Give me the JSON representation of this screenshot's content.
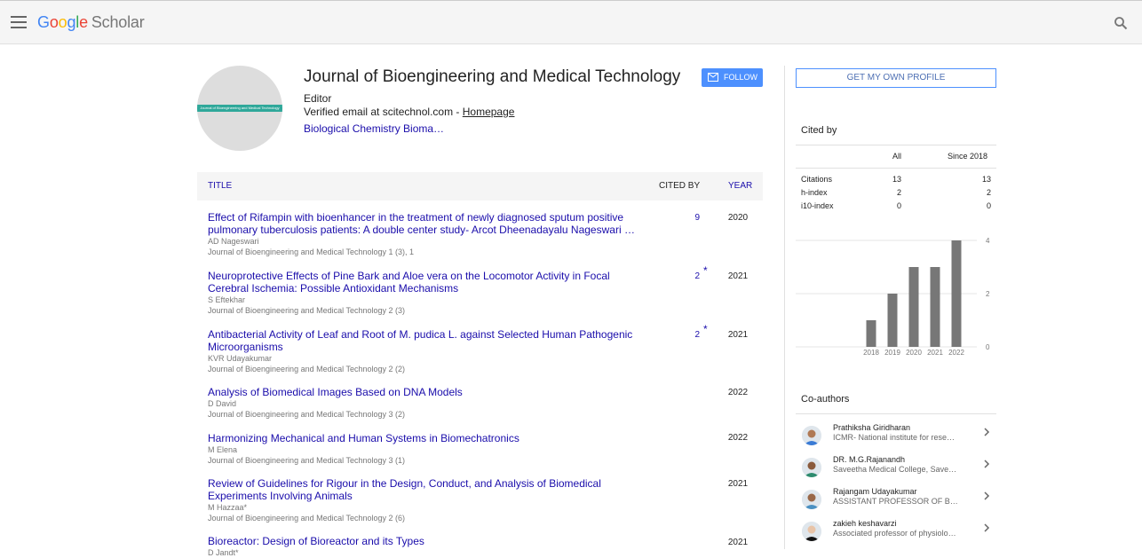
{
  "header": {
    "logo_google": [
      "G",
      "o",
      "o",
      "g",
      "l",
      "e"
    ],
    "logo_scholar": "Scholar"
  },
  "profile": {
    "avatar_band_text": "Journal of Bioengineering and Medical Technology",
    "name": "Journal of Bioengineering and Medical Technology",
    "affiliation": "Editor",
    "email_prefix": "Verified email at scitechnol.com - ",
    "homepage_label": "Homepage",
    "interests": "Biological Chemistry Bioma…",
    "follow_label": "FOLLOW"
  },
  "table": {
    "headers": {
      "title": "TITLE",
      "cited_by": "CITED BY",
      "year": "YEAR"
    },
    "rows": [
      {
        "title": "Effect of Rifampin with bioenhancer in the treatment of newly diagnosed sputum positive pulmonary tuberculosis patients: A double center study- Arcot Dheenadayalu Nageswari …",
        "authors": "AD Nageswari",
        "venue": "Journal of Bioengineering and Medical Technology 1 (3), 1",
        "cited": "9",
        "star": "",
        "year": "2020"
      },
      {
        "title": "Neuroprotective Effects of Pine Bark and Aloe vera on the Locomotor Activity in Focal Cerebral Ischemia: Possible Antioxidant Mechanisms",
        "authors": "S Eftekhar",
        "venue": "Journal of Bioengineering and Medical Technology 2 (3)",
        "cited": "2",
        "star": "*",
        "year": "2021"
      },
      {
        "title": "Antibacterial Activity of Leaf and Root of M. pudica L. against Selected Human Pathogenic Microorganisms",
        "authors": "KVR Udayakumar",
        "venue": "Journal of Bioengineering and Medical Technology 2 (2)",
        "cited": "2",
        "star": "*",
        "year": "2021"
      },
      {
        "title": "Analysis of Biomedical Images Based on DNA Models",
        "authors": "D David",
        "venue": "Journal of Bioengineering and Medical Technology 3 (2)",
        "cited": "",
        "star": "",
        "year": "2022"
      },
      {
        "title": "Harmonizing Mechanical and Human Systems in Biomechatronics",
        "authors": "M Elena",
        "venue": "Journal of Bioengineering and Medical Technology 3 (1)",
        "cited": "",
        "star": "",
        "year": "2022"
      },
      {
        "title": "Review of Guidelines for Rigour in the Design, Conduct, and Analysis of Biomedical Experiments Involving Animals",
        "authors": "M Hazzaa*",
        "venue": "Journal of Bioengineering and Medical Technology 2 (6)",
        "cited": "",
        "star": "",
        "year": "2021"
      },
      {
        "title": "Bioreactor: Design of Bioreactor and its Types",
        "authors": "D Jandt*",
        "venue": "",
        "cited": "",
        "star": "",
        "year": "2021"
      }
    ]
  },
  "sidebar": {
    "get_profile_label": "GET MY OWN PROFILE",
    "cited_by_title": "Cited by",
    "col_all": "All",
    "col_since": "Since 2018",
    "stats": [
      {
        "label": "Citations",
        "all": "13",
        "since": "13"
      },
      {
        "label": "h-index",
        "all": "2",
        "since": "2"
      },
      {
        "label": "i10-index",
        "all": "0",
        "since": "0"
      }
    ],
    "coauthors_title": "Co-authors",
    "coauthors": [
      {
        "name": "Prathiksha Giridharan",
        "inst": "ICMR- National institute for rese…",
        "skin": "#b07a55",
        "shirt": "#3a7bd5"
      },
      {
        "name": "DR. M.G.Rajanandh",
        "inst": "Saveetha Medical College, Save…",
        "skin": "#8a5a3c",
        "shirt": "#2e8b6e"
      },
      {
        "name": "Rajangam Udayakumar",
        "inst": "ASSISTANT PROFESSOR OF B…",
        "skin": "#9a6848",
        "shirt": "#4a90c2"
      },
      {
        "name": "zakieh keshavarzi",
        "inst": "Associated professor of physiolo…",
        "skin": "#e8c4a8",
        "shirt": "#111111"
      }
    ]
  },
  "chart_data": {
    "type": "bar",
    "categories": [
      "2018",
      "2019",
      "2020",
      "2021",
      "2022"
    ],
    "values": [
      1,
      2,
      3,
      3,
      4
    ],
    "yticks": [
      0,
      2,
      4
    ],
    "ylim": [
      0,
      4
    ],
    "bar_color": "#777777"
  }
}
